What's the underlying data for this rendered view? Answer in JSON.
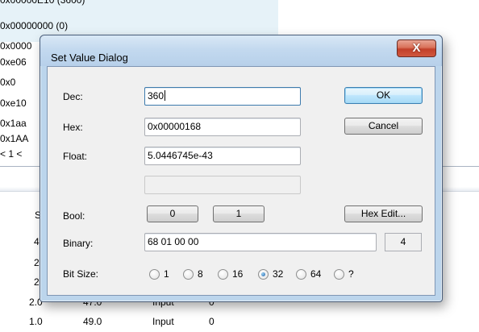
{
  "background": {
    "hex_lines": [
      "0x00000E10 (3600)",
      "0x00000000 (0)",
      "0x0000",
      "0xe06",
      "0x0",
      "0xe10",
      "0x1aa",
      "0x1AA",
      "< 1 <"
    ],
    "table_rows": [
      {
        "c1": "4",
        "c2": "",
        "c3": "",
        "c4": ""
      },
      {
        "c1": "2",
        "c2": "",
        "c3": "",
        "c4": ""
      },
      {
        "c1": "2",
        "c2": "",
        "c3": "",
        "c4": ""
      },
      {
        "c1": "2.0",
        "c2": "47.0",
        "c3": "Input",
        "c4": "0"
      },
      {
        "c1": "1.0",
        "c2": "49.0",
        "c3": "Input",
        "c4": "0"
      }
    ],
    "col_header_partial": "S"
  },
  "dialog": {
    "title": "Set Value Dialog",
    "close_label": "X",
    "dec_label": "Dec:",
    "dec_value": "360",
    "hex_label": "Hex:",
    "hex_value": "0x00000168",
    "float_label": "Float:",
    "float_value": "5.0446745e-43",
    "extra_value": "",
    "bool_label": "Bool:",
    "bool_false": "0",
    "bool_true": "1",
    "binary_label": "Binary:",
    "binary_value": "68 01 00 00",
    "byte_count": "4",
    "bitsize_label": "Bit Size:",
    "bitsize_options": [
      "1",
      "8",
      "16",
      "32",
      "64",
      "?"
    ],
    "bitsize_selected": "32",
    "ok_label": "OK",
    "cancel_label": "Cancel",
    "hex_edit_label": "Hex Edit..."
  }
}
